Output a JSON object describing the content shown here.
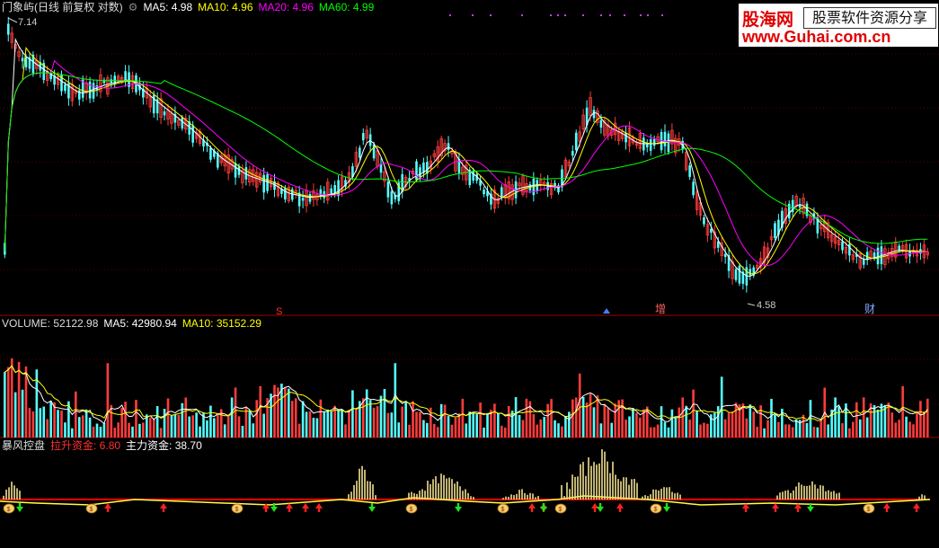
{
  "main": {
    "title": "门象屿(日线 前复权 对数)",
    "ma5": "MA5: 4.98",
    "ma10": "MA10: 4.96",
    "ma20": "MA20: 4.96",
    "ma60": "MA60: 4.99",
    "high_label": "7.14",
    "low_label": "4.58",
    "markers": [
      "S",
      "增",
      "财"
    ]
  },
  "volume": {
    "label": "VOLUME: 52122.98",
    "ma5": "MA5: 42980.94",
    "ma10": "MA10: 35152.29"
  },
  "indicator": {
    "name": "暴风控盘",
    "lift_fund": "拉升资金: 6.80",
    "main_fund": "主力资金: 38.70"
  },
  "watermark": {
    "brand": "股海网",
    "slogan": "股票软件资源分享",
    "url": "www.Guhai.com.cn"
  },
  "colors": {
    "background": "#000000",
    "up": "#ff3c3c",
    "down": "#54ffff",
    "ma5": "#ffffff",
    "ma10": "#ffff00",
    "ma20": "#ff00ff",
    "ma60": "#00ff00",
    "baseline": "#ff0000"
  },
  "icons": [
    "money-bag-icon",
    "up-arrow-icon",
    "down-arrow-icon",
    "up-triangle-icon"
  ]
}
